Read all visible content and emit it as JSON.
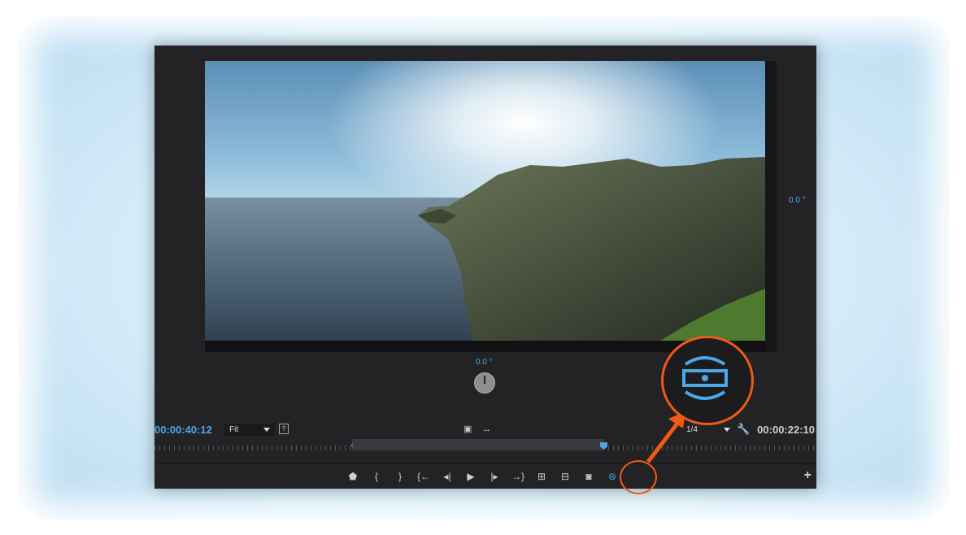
{
  "viewer": {
    "angle_vertical": "0.0 °",
    "angle_horizontal": "0.0 °"
  },
  "timecodes": {
    "current": "00:00:40:12",
    "duration": "00:00:22:10"
  },
  "zoom": {
    "selected": "Fit"
  },
  "resolution": {
    "selected": "1/4"
  },
  "controls": [
    {
      "name": "marker-icon",
      "glyph": "⬟"
    },
    {
      "name": "mark-in-icon",
      "glyph": "{"
    },
    {
      "name": "mark-out-icon",
      "glyph": "}"
    },
    {
      "name": "go-to-in-icon",
      "glyph": "{←"
    },
    {
      "name": "step-back-icon",
      "glyph": "◂|"
    },
    {
      "name": "play-icon",
      "glyph": "▶"
    },
    {
      "name": "step-forward-icon",
      "glyph": "|▸"
    },
    {
      "name": "go-to-out-icon",
      "glyph": "→}"
    },
    {
      "name": "insert-icon",
      "glyph": "⊞"
    },
    {
      "name": "overwrite-icon",
      "glyph": "⊟"
    },
    {
      "name": "export-frame-icon",
      "glyph": "◙"
    },
    {
      "name": "vr-video-toggle-icon",
      "glyph": "⊜"
    }
  ],
  "colors": {
    "accent": "#4aa8e6",
    "highlight": "#f05a14",
    "panel": "#232325"
  }
}
